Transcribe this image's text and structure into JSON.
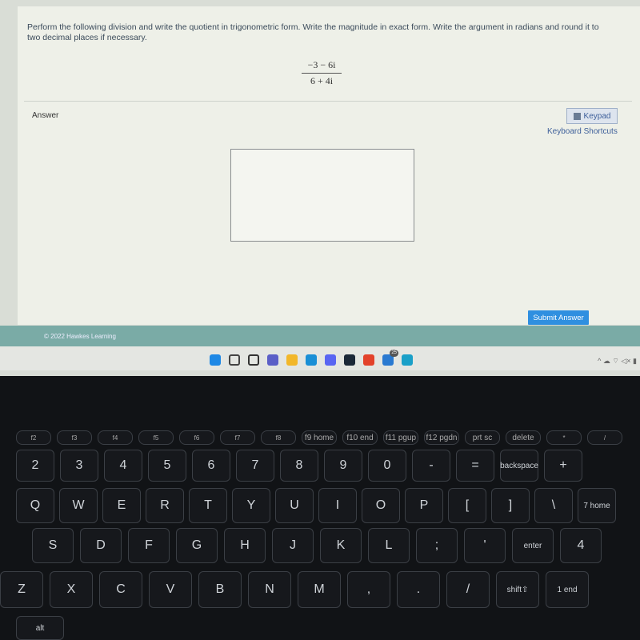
{
  "question": {
    "text": "Perform the following division and write the quotient in trigonometric form. Write the magnitude in exact form. Write the argument in radians and round it to two decimal places if necessary.",
    "numerator": "−3 − 6i",
    "denominator": "6 + 4i"
  },
  "answer": {
    "label": "Answer",
    "keypad_label": "Keypad",
    "shortcuts_label": "Keyboard Shortcuts",
    "input_value": "",
    "submit_label": "Submit Answer"
  },
  "footer": {
    "copyright": "© 2022 Hawkes Learning"
  },
  "taskbar": {
    "icons": [
      "windows-start-icon",
      "search-icon",
      "task-view-icon",
      "teams-chat-icon",
      "file-explorer-icon",
      "edge-icon",
      "discord-icon",
      "steam-icon",
      "office-icon",
      "mail-icon",
      "edge-dev-icon"
    ],
    "mail_badge": "25",
    "tray": "^ ☁ ⌔ ◁× ▮"
  },
  "colors": {
    "submit": "#2f8fe0",
    "footer": "#7aaba6",
    "link": "#3d5f9a"
  },
  "keyboard": {
    "fn_row": [
      "f2",
      "f3",
      "f4",
      "f5",
      "f6",
      "f7",
      "f8",
      "f9 home",
      "f10 end",
      "f11 pgup",
      "f12 pgdn",
      "prt sc",
      "delete",
      "*",
      "/"
    ],
    "num_row": [
      "2",
      "3",
      "4",
      "5",
      "6",
      "7",
      "8",
      "9",
      "0",
      "-",
      "=",
      "backspace",
      "+"
    ],
    "q_row": [
      "Q",
      "W",
      "E",
      "R",
      "T",
      "Y",
      "U",
      "I",
      "O",
      "P",
      "[",
      "]",
      "\\",
      "7 home"
    ],
    "a_row": [
      "S",
      "D",
      "F",
      "G",
      "H",
      "J",
      "K",
      "L",
      ";",
      "'",
      "enter",
      "4"
    ],
    "z_row": [
      "Z",
      "X",
      "C",
      "V",
      "B",
      "N",
      "M",
      ",",
      ".",
      "/",
      "shift⇧",
      "1 end"
    ],
    "bottom_row": [
      "alt"
    ]
  }
}
